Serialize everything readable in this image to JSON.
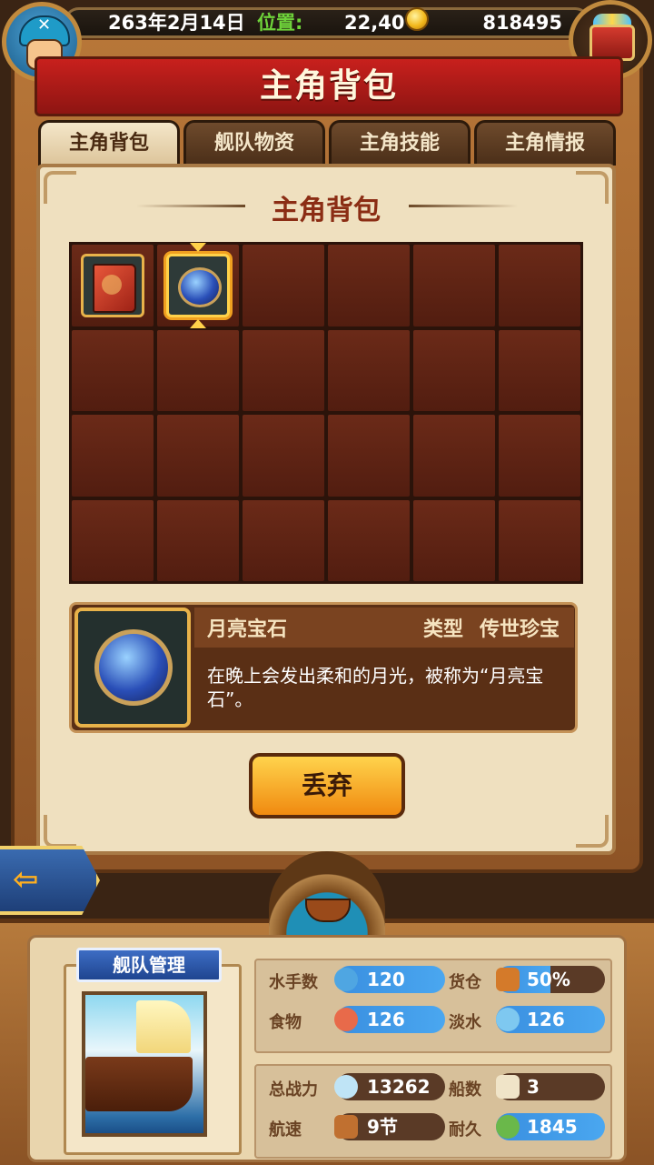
{
  "topbar": {
    "date": "263年2月14日",
    "position_label": "位置:",
    "position_value": "22,40",
    "gold": "818495"
  },
  "header": {
    "title": "主角背包"
  },
  "tabs": [
    {
      "label": "主角背包",
      "active": true
    },
    {
      "label": "舰队物资",
      "active": false
    },
    {
      "label": "主角技能",
      "active": false
    },
    {
      "label": "主角情报",
      "active": false
    }
  ],
  "inventory": {
    "section_title": "主角背包",
    "rows": 4,
    "columns": 6,
    "items": [
      {
        "icon": "red-book-icon"
      },
      {
        "icon": "moon-gem-icon",
        "selected": true
      }
    ]
  },
  "detail": {
    "name": "月亮宝石",
    "type_label": "类型",
    "type_value": "传世珍宝",
    "description": "在晚上会发出柔和的月光，被称为“月亮宝石”。"
  },
  "actions": {
    "discard_label": "丢弃"
  },
  "fleet": {
    "banner": "舰队管理",
    "stats": {
      "sailors_label": "水手数",
      "sailors": "120",
      "cargo_label": "货仓",
      "cargo": "50%",
      "food_label": "食物",
      "food": "126",
      "water_label": "淡水",
      "water": "126",
      "power_label": "总战力",
      "power": "13262",
      "ships_label": "船数",
      "ships": "3",
      "speed_label": "航速",
      "speed": "9节",
      "durability_label": "耐久",
      "durability": "1845"
    }
  },
  "colors": {
    "accent_red": "#c8201d",
    "gold": "#f2b81c",
    "position_green": "#6ed23a",
    "pill_blue": "#3a8fe0"
  }
}
